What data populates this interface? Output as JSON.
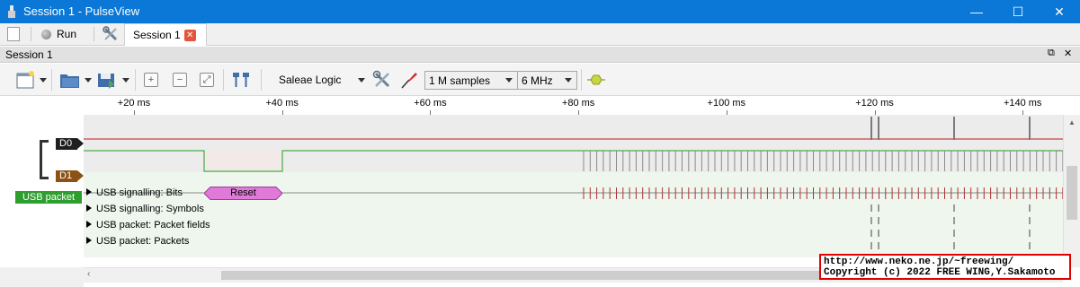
{
  "window": {
    "title": "Session 1 - PulseView",
    "minimize_glyph": "—",
    "maximize_glyph": "☐",
    "close_glyph": "✕"
  },
  "main_toolbar": {
    "run_label": "Run",
    "tab_label": "Session 1",
    "tab_close_glyph": "✕"
  },
  "session_bar": {
    "title": "Session 1",
    "float_glyph": "⧉",
    "close_glyph": "✕"
  },
  "toolbar": {
    "device": "Saleae Logic",
    "samples": "1 M samples",
    "samplerate": "6 MHz",
    "zoom_in_glyph": "+",
    "zoom_out_glyph": "−",
    "zoom_fit_glyph": "⤢"
  },
  "ruler": {
    "ticks": [
      "+20 ms",
      "+40 ms",
      "+60 ms",
      "+80 ms",
      "+100 ms",
      "+120 ms",
      "+140 ms"
    ]
  },
  "channels": [
    {
      "name": "D0",
      "color": "#1f1f1f"
    },
    {
      "name": "D1",
      "color": "#8c5214"
    }
  ],
  "decoder": {
    "label": "USB packet",
    "color": "#2e9e2e",
    "rows": [
      "USB signalling: Bits",
      "USB signalling: Symbols",
      "USB packet: Packet fields",
      "USB packet: Packets"
    ],
    "annotation": "Reset",
    "annotation_color": "#e07ad8"
  },
  "watermark": {
    "line1": "http://www.neko.ne.jp/~freewing/",
    "line2": "Copyright (c) 2022 FREE WING,Y.Sakamoto"
  },
  "colors": {
    "titlebar": "#0b77d6",
    "d0_trace": "#c01818",
    "d1_trace": "#1f9e1f"
  }
}
